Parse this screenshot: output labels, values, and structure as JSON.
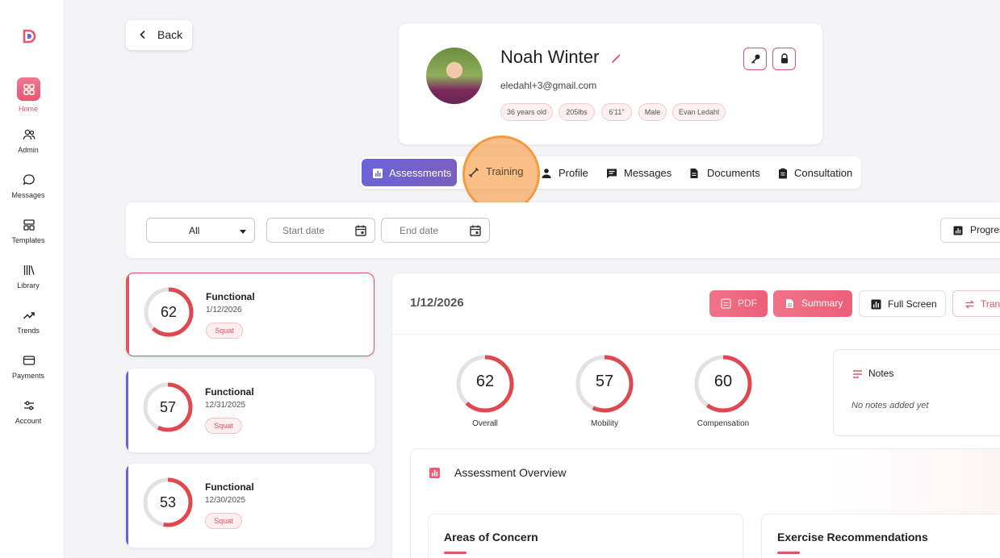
{
  "sidebar": {
    "items": [
      {
        "label": "Home",
        "icon": "home-icon",
        "active": true
      },
      {
        "label": "Admin",
        "icon": "users-icon"
      },
      {
        "label": "Messages",
        "icon": "chat-icon"
      },
      {
        "label": "Templates",
        "icon": "templates-icon"
      },
      {
        "label": "Library",
        "icon": "library-icon"
      },
      {
        "label": "Trends",
        "icon": "trend-icon"
      },
      {
        "label": "Payments",
        "icon": "card-icon"
      },
      {
        "label": "Account",
        "icon": "sliders-icon"
      }
    ]
  },
  "back": {
    "label": "Back"
  },
  "profile": {
    "name": "Noah Winter",
    "email": "eledahl+3@gmail.com",
    "tags": [
      "36 years old",
      "205lbs",
      "6'11\"",
      "Male",
      "Evan Ledahl"
    ]
  },
  "tabs": [
    {
      "label": "Assessments",
      "icon": "chart-icon",
      "active": true
    },
    {
      "label": "Training",
      "icon": "dumbbell-icon"
    },
    {
      "label": "Profile",
      "icon": "person-icon"
    },
    {
      "label": "Messages",
      "icon": "message-icon"
    },
    {
      "label": "Documents",
      "icon": "document-icon"
    },
    {
      "label": "Consultation",
      "icon": "clipboard-icon"
    }
  ],
  "filters": {
    "type_value": "All",
    "start_placeholder": "Start date",
    "end_placeholder": "End date",
    "progress_label": "Progres"
  },
  "assessments": [
    {
      "score": "62",
      "title": "Functional",
      "date": "1/12/2026",
      "tag": "Squat",
      "fraction": 0.62,
      "selected": true
    },
    {
      "score": "57",
      "title": "Functional",
      "date": "12/31/2025",
      "tag": "Squat",
      "fraction": 0.57
    },
    {
      "score": "53",
      "title": "Functional",
      "date": "12/30/2025",
      "tag": "Squat",
      "fraction": 0.53
    }
  ],
  "detail": {
    "date": "1/12/2026",
    "actions": {
      "pdf": "PDF",
      "summary": "Summary",
      "fullscreen": "Full Screen",
      "trans": "Tran"
    },
    "scores": [
      {
        "value": "62",
        "label": "Overall",
        "fraction": 0.62
      },
      {
        "value": "57",
        "label": "Mobility",
        "fraction": 0.57
      },
      {
        "value": "60",
        "label": "Compensation",
        "fraction": 0.6
      }
    ],
    "notes": {
      "title": "Notes",
      "empty": "No notes added yet"
    },
    "overview": {
      "title": "Assessment Overview",
      "areas_title": "Areas of Concern",
      "exercise_title": "Exercise Recommendations"
    }
  },
  "colors": {
    "accent": "#e05266",
    "tab_active": "#6a63d8",
    "ring_track": "#e2e2e4",
    "ring_fill": "#e0484f",
    "cursor": "#f59a3e"
  }
}
